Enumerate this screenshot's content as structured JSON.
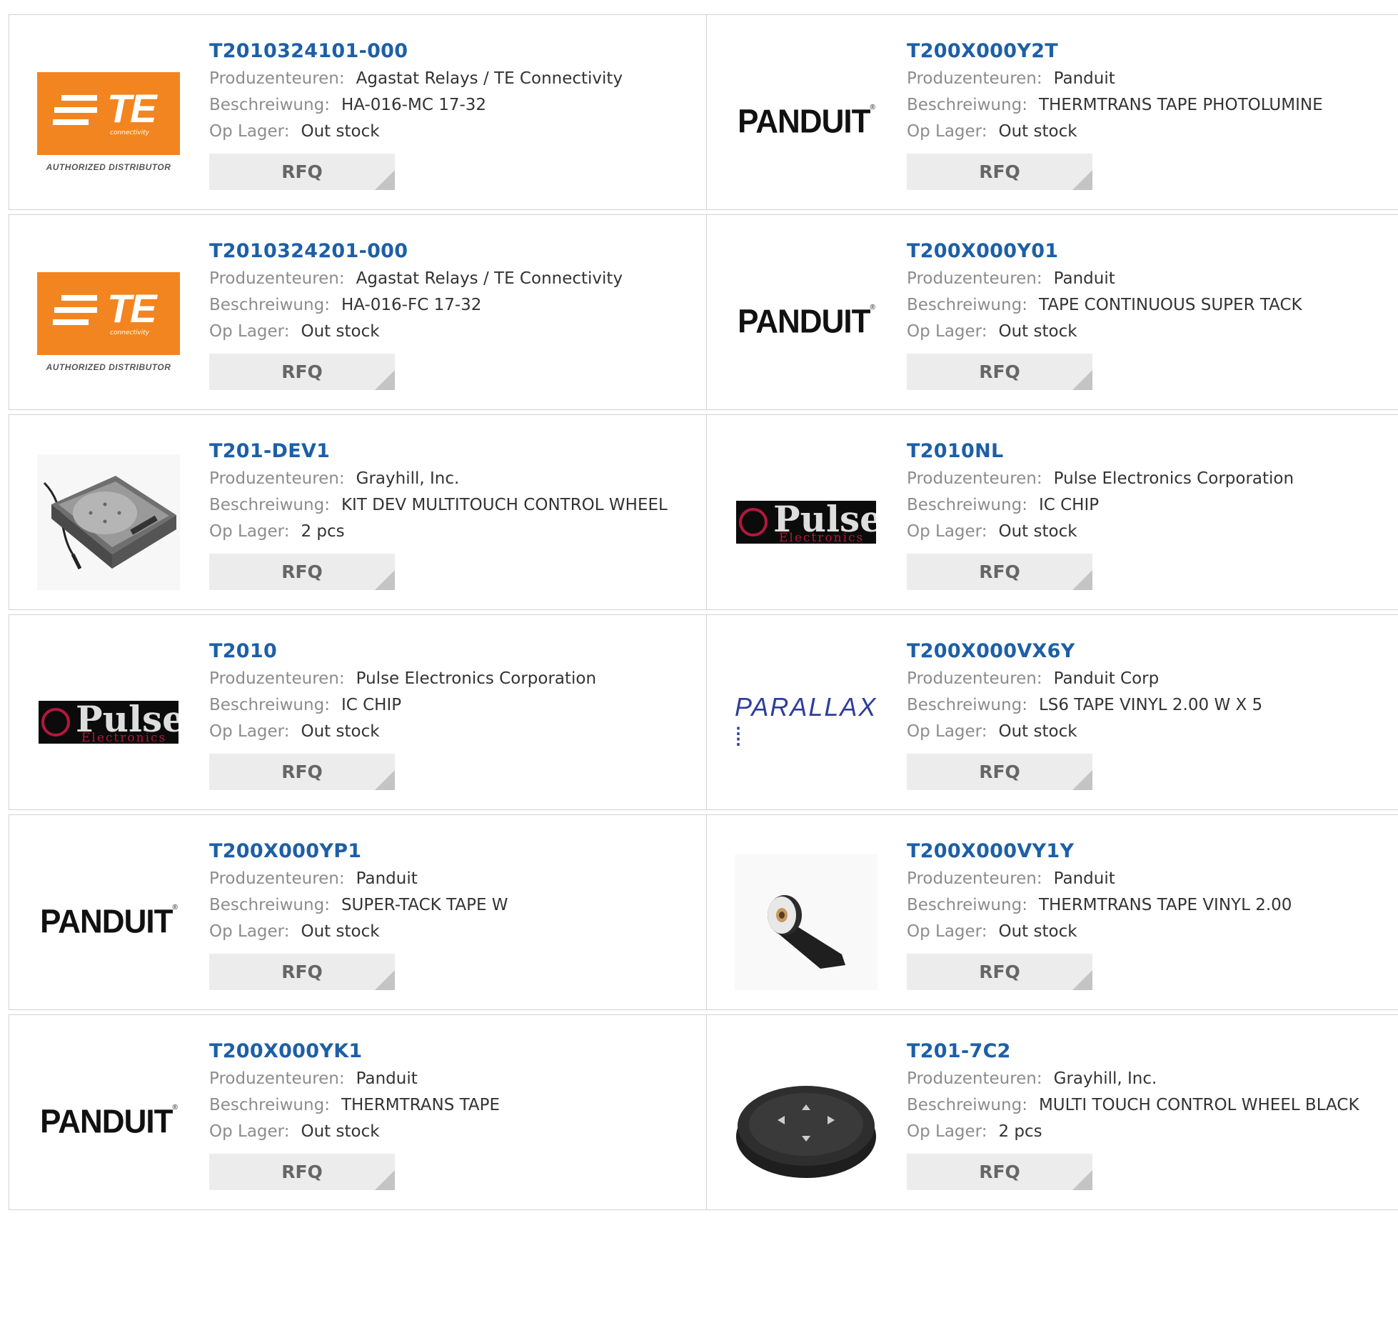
{
  "labels": {
    "manufacturer": "Produzenteuren:",
    "description": "Beschreiwung:",
    "stock": "Op Lager:",
    "rfq": "RFQ"
  },
  "logo_text": {
    "te_word": "TE",
    "te_sub": "connectivity",
    "te_authorized": "AUTHORIZED DISTRIBUTOR",
    "panduit": "PANDUIT",
    "pulse_word": "Pulse",
    "pulse_sub": "Electronics",
    "parallax": "PARALLAX"
  },
  "colors": {
    "part_number": "#1d5fa7",
    "te_orange": "#f2851f",
    "rfq_bg": "#ececec"
  },
  "products": [
    {
      "part": "T2010324101-000",
      "manufacturer": "Agastat Relays / TE Connectivity",
      "description": "HA-016-MC 17-32",
      "stock": "Out stock",
      "logo": "te-logo"
    },
    {
      "part": "T200X000Y2T",
      "manufacturer": "Panduit",
      "description": "THERMTRANS TAPE PHOTOLUMINE",
      "stock": "Out stock",
      "logo": "panduit-logo"
    },
    {
      "part": "T2010324201-000",
      "manufacturer": "Agastat Relays / TE Connectivity",
      "description": "HA-016-FC 17-32",
      "stock": "Out stock",
      "logo": "te-logo"
    },
    {
      "part": "T200X000Y01",
      "manufacturer": "Panduit",
      "description": "TAPE CONTINUOUS SUPER TACK",
      "stock": "Out stock",
      "logo": "panduit-logo"
    },
    {
      "part": "T201-DEV1",
      "manufacturer": "Grayhill, Inc.",
      "description": "KIT DEV MULTITOUCH CONTROL WHEEL",
      "stock": "2 pcs",
      "logo": "devkit-photo"
    },
    {
      "part": "T2010NL",
      "manufacturer": "Pulse Electronics Corporation",
      "description": "IC CHIP",
      "stock": "Out stock",
      "logo": "pulse-logo"
    },
    {
      "part": "T2010",
      "manufacturer": "Pulse Electronics Corporation",
      "description": "IC CHIP",
      "stock": "Out stock",
      "logo": "pulse-logo"
    },
    {
      "part": "T200X000VX6Y",
      "manufacturer": "Panduit Corp",
      "description": "LS6 TAPE VINYL 2.00 W X 5",
      "stock": "Out stock",
      "logo": "parallax-logo"
    },
    {
      "part": "T200X000YP1",
      "manufacturer": "Panduit",
      "description": "SUPER-TACK TAPE W",
      "stock": "Out stock",
      "logo": "panduit-logo"
    },
    {
      "part": "T200X000VY1Y",
      "manufacturer": "Panduit",
      "description": "THERMTRANS TAPE VINYL 2.00",
      "stock": "Out stock",
      "logo": "tape-roll-photo"
    },
    {
      "part": "T200X000YK1",
      "manufacturer": "Panduit",
      "description": "THERMTRANS TAPE",
      "stock": "Out stock",
      "logo": "panduit-logo"
    },
    {
      "part": "T201-7C2",
      "manufacturer": "Grayhill, Inc.",
      "description": "MULTI TOUCH CONTROL WHEEL BLACK",
      "stock": "2 pcs",
      "logo": "control-wheel-photo"
    }
  ]
}
